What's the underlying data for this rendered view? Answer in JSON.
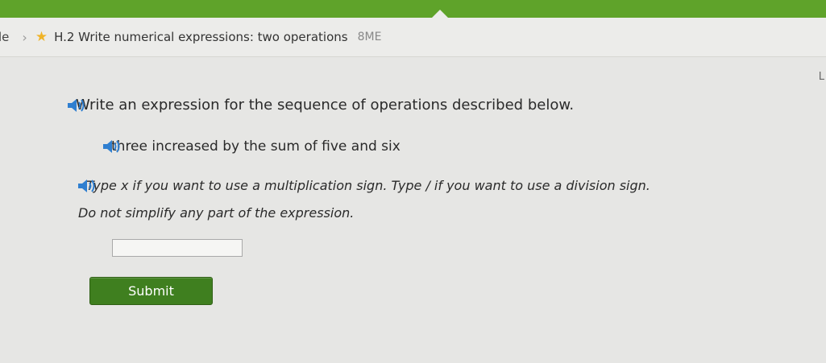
{
  "breadcrumb": {
    "prev": "le",
    "separator": "›",
    "star": "★",
    "title": "H.2 Write numerical expressions: two operations",
    "code": "8ME"
  },
  "question": {
    "prompt": "Write an expression for the sequence of operations described below.",
    "phrase": "three increased by the sum of five and six",
    "instruction_line1": "Type x if you want to use a multiplication sign. Type / if you want to use a division sign.",
    "instruction_line2": "Do not simplify any part of the expression."
  },
  "answer": {
    "value": ""
  },
  "submit_label": "Submit",
  "edge_mark": "L",
  "colors": {
    "accent": "#5fa32a",
    "button": "#3f7f1f",
    "speaker": "#2f7fd0"
  }
}
